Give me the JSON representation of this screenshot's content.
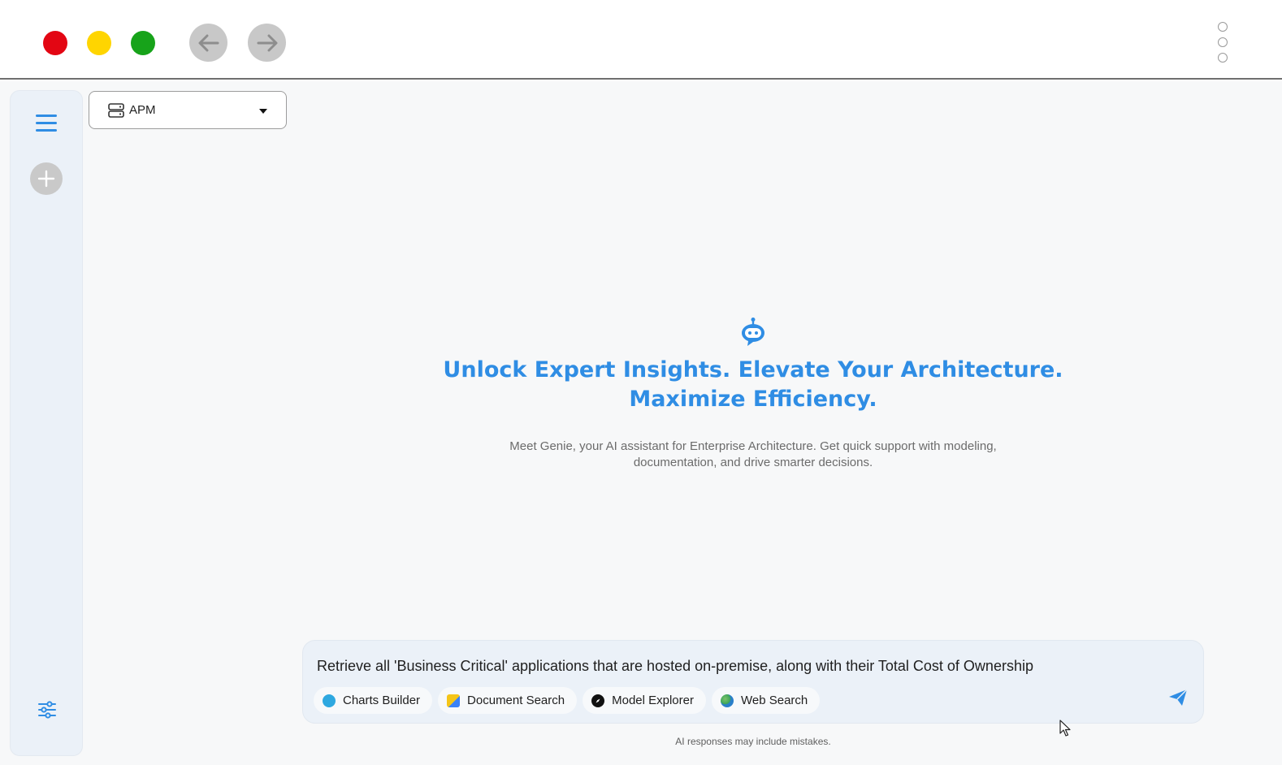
{
  "window": {
    "back_icon": "arrow-left-icon",
    "forward_icon": "arrow-right-icon",
    "menu_icon": "more-vertical-icon"
  },
  "sidebar": {
    "menu_icon": "hamburger-icon",
    "new_chat_icon": "plus-icon",
    "settings_icon": "sliders-icon"
  },
  "selector": {
    "icon": "server-icon",
    "value": "APM"
  },
  "hero": {
    "icon": "robot-icon",
    "headline_line1": "Unlock Expert Insights. Elevate Your Architecture.",
    "headline_line2": "Maximize Efficiency.",
    "description": "Meet Genie, your AI assistant for Enterprise Architecture. Get quick support with modeling, documentation, and drive smarter decisions."
  },
  "composer": {
    "input_value": "Retrieve all 'Business Critical' applications that are hosted on-premise, along with their Total Cost of Ownership",
    "tools": [
      {
        "label": "Charts Builder",
        "icon": "charts-icon"
      },
      {
        "label": "Document Search",
        "icon": "document-icon"
      },
      {
        "label": "Model Explorer",
        "icon": "compass-icon"
      },
      {
        "label": "Web Search",
        "icon": "globe-icon"
      }
    ],
    "send_icon": "send-icon"
  },
  "footer": {
    "disclaimer": "AI responses may include mistakes."
  },
  "colors": {
    "accent": "#2f8de4",
    "sidebar_bg": "#ebf1f8",
    "traffic_red": "#e30613",
    "traffic_yellow": "#ffd500",
    "traffic_green": "#17a31a"
  }
}
